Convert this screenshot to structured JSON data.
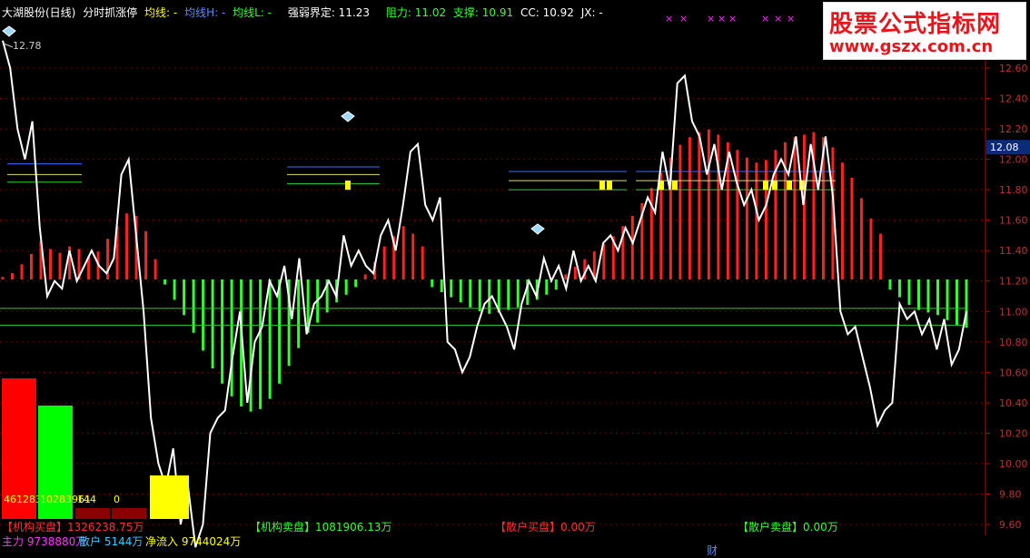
{
  "header": {
    "stock": "大湖股份(日线)",
    "indicator": "分时抓涨停",
    "ma_label": "均线: -",
    "mah_label": "均线H: -",
    "mal_label": "均线L: -",
    "strength_label": "强弱界定: 11.23",
    "resistance_label": "阻力: 11.02",
    "support_label": "支撑: 10.91",
    "cc_label": "CC: 10.92",
    "jx_label": "JX: -"
  },
  "watermark": {
    "line1": "股票公式指标网",
    "line2": "www.gszx.com.cn"
  },
  "bottom": {
    "inst_buy": "【机构买盘】1326238.75万",
    "inst_sell": "【机构卖盘】1081906.13万",
    "retail_buy": "【散户买盘】0.00万",
    "retail_sell": "【散户卖盘】0.00万",
    "main": "主力 9738880万",
    "retail": "散户 5144万",
    "net": "净流入 9744024万",
    "cai": "财"
  },
  "colors": {
    "red": "#ff2a2a",
    "green": "#33ff33",
    "yellow": "#ffff00",
    "white": "#ffffff",
    "blue": "#5b8bff",
    "magenta": "#ff33ff",
    "axis": "#ff3333"
  },
  "chart_data": {
    "type": "line",
    "ylim": [
      9.5,
      12.8
    ],
    "y_ticks": [
      "12.60",
      "12.40",
      "12.20",
      "12.00",
      "11.80",
      "11.60",
      "11.40",
      "11.20",
      "11.00",
      "10.80",
      "10.60",
      "10.40",
      "10.20",
      "10.00",
      "9.80",
      "9.60"
    ],
    "current_label": "12.08",
    "max_label": "12.78",
    "price": [
      12.78,
      12.6,
      12.2,
      12.0,
      12.25,
      11.55,
      11.1,
      11.2,
      11.15,
      11.4,
      11.2,
      11.3,
      11.4,
      11.3,
      11.25,
      11.35,
      11.9,
      12.0,
      11.5,
      11.0,
      10.3,
      10.0,
      9.85,
      10.1,
      9.6,
      9.85,
      9.45,
      9.6,
      10.2,
      10.3,
      10.35,
      10.7,
      11.0,
      10.4,
      10.8,
      10.9,
      11.2,
      11.1,
      11.3,
      10.95,
      11.35,
      10.85,
      11.05,
      11.1,
      11.2,
      11.1,
      11.5,
      11.3,
      11.4,
      11.3,
      11.25,
      11.5,
      11.6,
      11.4,
      11.7,
      12.05,
      12.1,
      11.7,
      11.6,
      11.75,
      10.8,
      10.75,
      10.6,
      10.7,
      10.9,
      11.05,
      11.1,
      11.0,
      10.9,
      10.75,
      11.05,
      11.2,
      11.1,
      11.35,
      11.2,
      11.3,
      11.15,
      11.4,
      11.2,
      11.3,
      11.2,
      11.45,
      11.5,
      11.4,
      11.55,
      11.45,
      11.6,
      11.75,
      11.65,
      12.05,
      11.8,
      12.5,
      12.55,
      12.25,
      12.15,
      11.9,
      12.1,
      11.8,
      12.05,
      11.85,
      11.7,
      11.8,
      11.6,
      11.7,
      11.9,
      12.0,
      11.9,
      12.15,
      11.7,
      12.1,
      11.8,
      12.15,
      11.75,
      11.0,
      10.85,
      10.9,
      10.7,
      10.5,
      10.25,
      10.35,
      10.4,
      11.05,
      10.95,
      11.0,
      10.85,
      10.95,
      10.75,
      10.95,
      10.65,
      10.75,
      11.0
    ],
    "histogram": [
      0.2,
      0.5,
      1.2,
      2.0,
      3.0,
      2.4,
      2.1,
      2.6,
      2.4,
      1.8,
      2.2,
      3.2,
      4.2,
      5.2,
      5.0,
      3.8,
      1.6,
      -0.4,
      -1.6,
      -2.8,
      -4.2,
      -5.6,
      -7.0,
      -8.2,
      -9.2,
      -10.0,
      -10.4,
      -10.2,
      -9.4,
      -8.2,
      -6.8,
      -5.4,
      -4.2,
      -3.4,
      -2.6,
      -1.8,
      -1.2,
      -0.6,
      0.4,
      1.4,
      2.6,
      3.4,
      4.2,
      3.6,
      2.6,
      -0.6,
      -1.0,
      -1.4,
      -1.8,
      -2.2,
      -2.5,
      -2.7,
      -2.6,
      -2.4,
      -2.2,
      -2.0,
      -1.6,
      -1.2,
      -0.8,
      0.4,
      1.0,
      1.6,
      2.2,
      2.8,
      3.4,
      4.2,
      5.0,
      6.0,
      7.2,
      8.4,
      9.6,
      10.6,
      11.2,
      11.6,
      11.8,
      11.4,
      10.8,
      10.2,
      9.6,
      9.2,
      9.4,
      10.2,
      10.8,
      11.2,
      11.4,
      11.6,
      11.2,
      10.4,
      9.2,
      8.0,
      6.4,
      4.8,
      3.6,
      -0.8,
      -1.4,
      -2.0,
      -2.4,
      -2.6,
      -2.8,
      -3.2,
      -3.6,
      -3.8
    ],
    "hist_bands": {
      "first_red_end": 17,
      "gap": [
        45,
        59
      ],
      "last_red_end": 93
    },
    "hist_bars": [
      {
        "label": "461283843",
        "value": 46128.38,
        "color": "#ff0000"
      },
      {
        "label": "10283961",
        "value": 1028.39,
        "color": "#00ff00"
      },
      {
        "label": "144",
        "value": 1.44,
        "color": "#8b0000"
      },
      {
        "label": "0",
        "value": 0,
        "color": "#8b0000"
      },
      {
        "label": "4",
        "value": 0.04,
        "color": "#ffff00"
      }
    ]
  }
}
